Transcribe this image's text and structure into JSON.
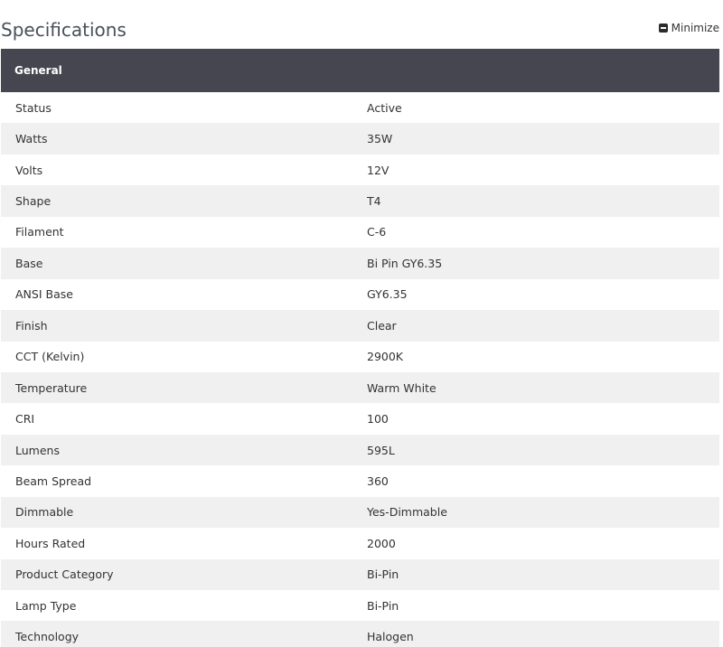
{
  "header": {
    "title": "Specifications",
    "minimize_label": "Minimize"
  },
  "section": {
    "label": "General"
  },
  "rows": [
    {
      "label": "Status",
      "value": "Active"
    },
    {
      "label": "Watts",
      "value": "35W"
    },
    {
      "label": "Volts",
      "value": "12V"
    },
    {
      "label": "Shape",
      "value": "T4"
    },
    {
      "label": "Filament",
      "value": "C-6"
    },
    {
      "label": "Base",
      "value": "Bi Pin GY6.35"
    },
    {
      "label": "ANSI Base",
      "value": "GY6.35"
    },
    {
      "label": "Finish",
      "value": "Clear"
    },
    {
      "label": "CCT (Kelvin)",
      "value": "2900K"
    },
    {
      "label": "Temperature",
      "value": "Warm White"
    },
    {
      "label": "CRI",
      "value": "100"
    },
    {
      "label": "Lumens",
      "value": "595L"
    },
    {
      "label": "Beam Spread",
      "value": "360"
    },
    {
      "label": "Dimmable",
      "value": "Yes-Dimmable"
    },
    {
      "label": "Hours Rated",
      "value": "2000"
    },
    {
      "label": "Product Category",
      "value": "Bi-Pin"
    },
    {
      "label": "Lamp Type",
      "value": "Bi-Pin"
    },
    {
      "label": "Technology",
      "value": "Halogen"
    }
  ],
  "colors": {
    "section_bar": "#454650",
    "alt_row": "#f0f0f0",
    "title_text": "#4a4f5a"
  }
}
